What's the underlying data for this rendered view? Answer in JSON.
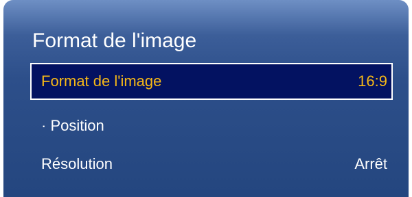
{
  "panel": {
    "title": "Format de l'image"
  },
  "menu": {
    "items": [
      {
        "label": "Format de l'image",
        "value": "16:9",
        "selected": true
      },
      {
        "label": "· Position",
        "value": "",
        "selected": false
      },
      {
        "label": "Résolution",
        "value": "Arrêt",
        "selected": false
      }
    ]
  },
  "colors": {
    "panel_top": "#6e8fc4",
    "panel_bottom": "#24467f",
    "selected_background": "#031261",
    "selected_text": "#f6b817",
    "text": "#ffffff"
  }
}
